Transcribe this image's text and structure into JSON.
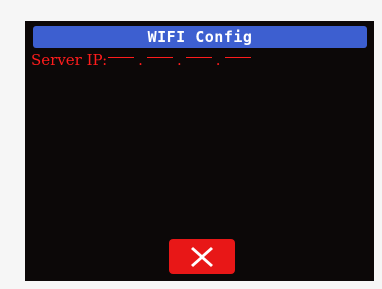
{
  "header": {
    "title": "WIFI Config"
  },
  "server": {
    "label": "Server IP:",
    "ip_octets": [
      "",
      "",
      "",
      ""
    ],
    "separator": "."
  },
  "actions": {
    "close_icon": "close-icon"
  },
  "colors": {
    "screen_background": "#0c0808",
    "title_bar": "#3d5fd0",
    "text_accent": "#ff1c1c",
    "close_button": "#e81717"
  }
}
